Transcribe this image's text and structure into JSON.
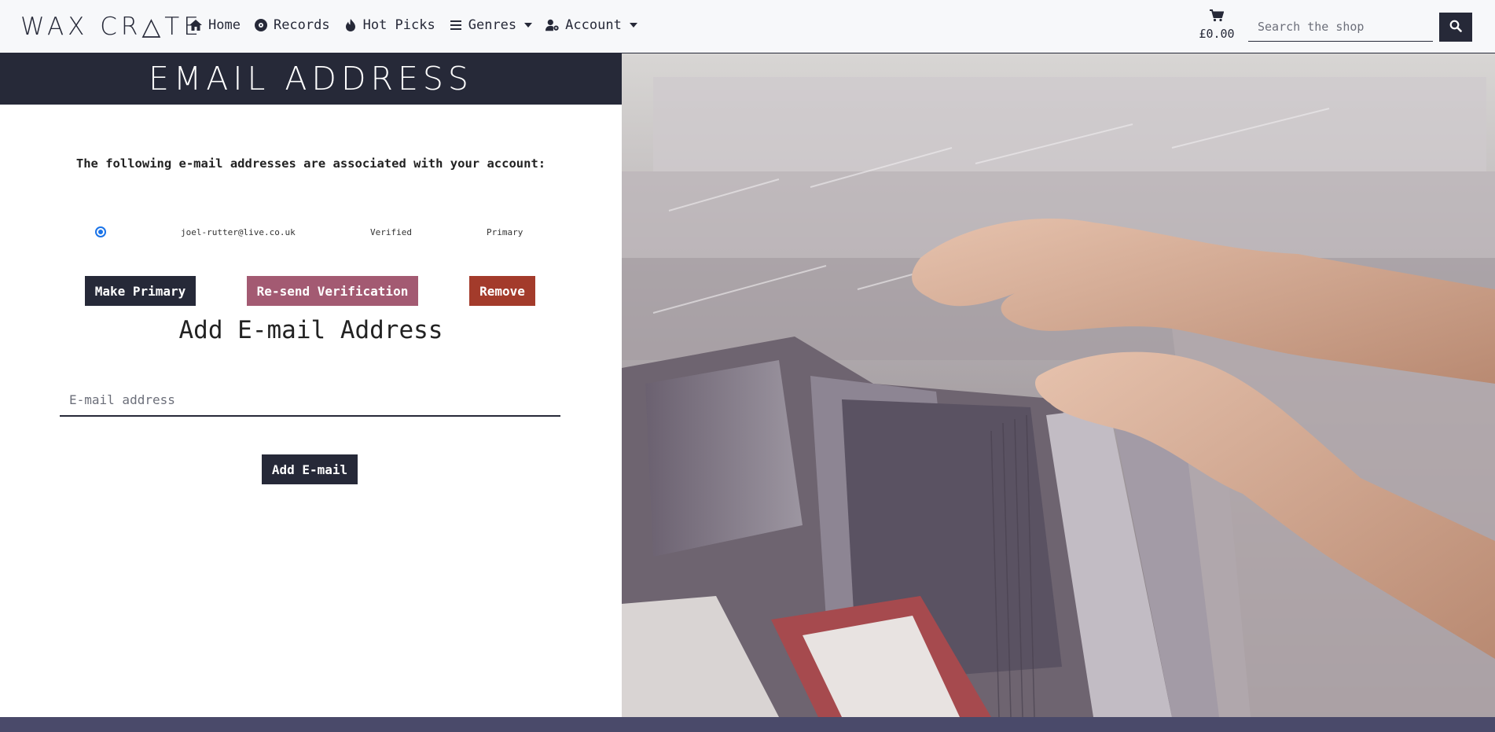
{
  "brand": "WAX CR△TE",
  "nav": {
    "items": [
      {
        "label": "Home",
        "icon": "home-icon"
      },
      {
        "label": "Records",
        "icon": "record-icon"
      },
      {
        "label": "Hot Picks",
        "icon": "flame-icon"
      },
      {
        "label": "Genres",
        "icon": "list-icon"
      },
      {
        "label": "Account",
        "icon": "user-gear-icon"
      }
    ],
    "cart_total": "£0.00",
    "search_placeholder": "Search the shop"
  },
  "page": {
    "title": "EMAIL ADDRESS",
    "intro": "The following e-mail addresses are associated with your account:",
    "email": {
      "address": "joel-rutter@live.co.uk",
      "status": "Verified",
      "role": "Primary"
    },
    "buttons": {
      "make_primary": "Make Primary",
      "resend": "Re-send Verification",
      "remove": "Remove"
    },
    "add_title": "Add E-mail Address",
    "add_placeholder": "E-mail address",
    "add_button": "Add E-mail"
  },
  "colors": {
    "dark": "#262938",
    "resend": "#a35a72",
    "remove": "#a33b2b",
    "footer": "#4a4a6a"
  }
}
